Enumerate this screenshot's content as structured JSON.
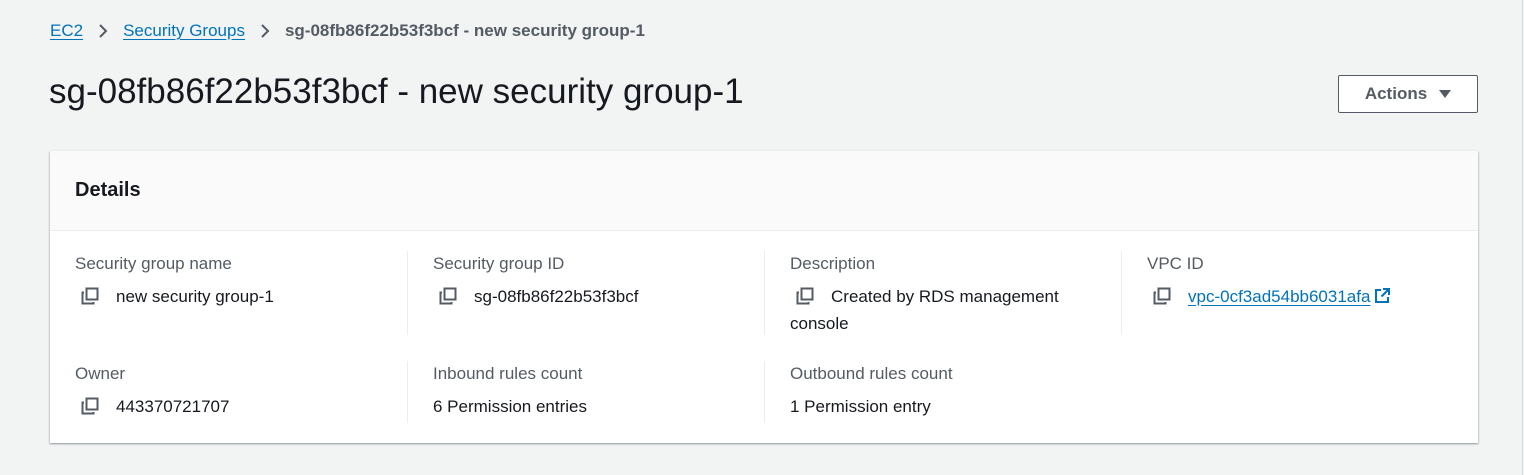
{
  "breadcrumb": {
    "items": [
      "EC2",
      "Security Groups"
    ],
    "current": "sg-08fb86f22b53f3bcf - new security group-1"
  },
  "page": {
    "title": "sg-08fb86f22b53f3bcf - new security group-1",
    "actions_label": "Actions"
  },
  "details": {
    "title": "Details",
    "fields": {
      "name": {
        "label": "Security group name",
        "value": "new security group-1"
      },
      "id": {
        "label": "Security group ID",
        "value": "sg-08fb86f22b53f3bcf"
      },
      "description": {
        "label": "Description",
        "value": "Created by RDS management console"
      },
      "vpc": {
        "label": "VPC ID",
        "value": "vpc-0cf3ad54bb6031afa"
      },
      "owner": {
        "label": "Owner",
        "value": "443370721707"
      },
      "inbound": {
        "label": "Inbound rules count",
        "value": "6 Permission entries"
      },
      "outbound": {
        "label": "Outbound rules count",
        "value": "1 Permission entry"
      }
    }
  },
  "icons": {
    "copy": "copy-icon",
    "external": "external-link-icon",
    "chevron": "chevron-right-icon",
    "caret": "caret-down-icon"
  },
  "colors": {
    "link": "#0073bb",
    "background": "#f2f3f3",
    "text": "#16191f",
    "label": "#545b64"
  }
}
